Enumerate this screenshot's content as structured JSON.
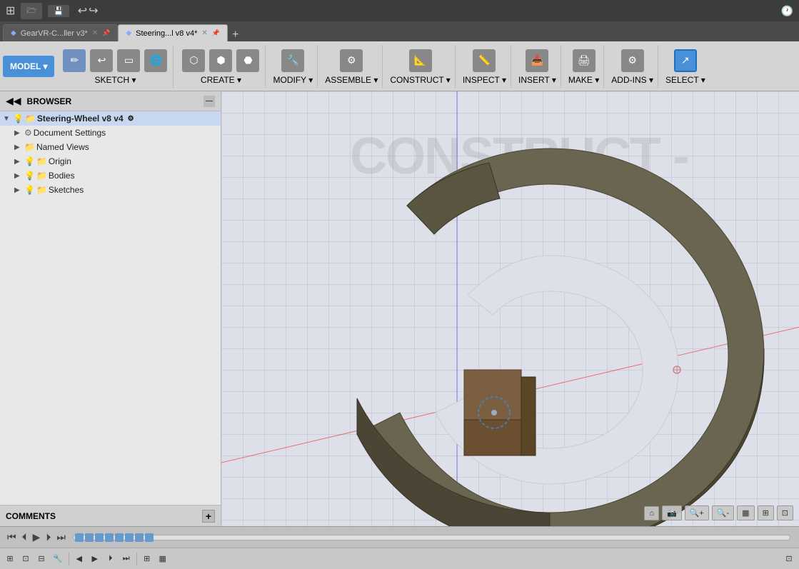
{
  "titlebar": {
    "app_grid_icon": "⊞",
    "file_btn": "File",
    "undo_icon": "↩",
    "redo_icon": "↪",
    "clock_icon": "🕐"
  },
  "tabs": [
    {
      "label": "GearVR-C...ller v3*",
      "active": false,
      "icon": "◆"
    },
    {
      "label": "Steering...l v8 v4*",
      "active": true,
      "icon": "◆"
    }
  ],
  "tab_add_label": "+",
  "toolbar": {
    "model_btn": "MODEL ▾",
    "groups": [
      {
        "name": "sketch",
        "label": "SKETCH ▾",
        "icons": [
          "✏️",
          "↩",
          "▭",
          "🌐"
        ]
      },
      {
        "name": "create",
        "label": "CREATE ▾",
        "icons": [
          "⬡",
          "⬢",
          "⬣"
        ]
      },
      {
        "name": "modify",
        "label": "MODIFY ▾",
        "icons": [
          "🔧"
        ]
      },
      {
        "name": "assemble",
        "label": "ASSEMBLE ▾",
        "icons": [
          "⚙"
        ]
      },
      {
        "name": "construct",
        "label": "CONSTRUCT ▾",
        "icons": [
          "📐"
        ]
      },
      {
        "name": "inspect",
        "label": "INSPECT ▾",
        "icons": [
          "📏"
        ]
      },
      {
        "name": "insert",
        "label": "INSERT ▾",
        "icons": [
          "📥"
        ]
      },
      {
        "name": "make",
        "label": "MAKE ▾",
        "icons": [
          "🖨"
        ]
      },
      {
        "name": "addins",
        "label": "ADD-INS ▾",
        "icons": [
          "⚙"
        ]
      },
      {
        "name": "select",
        "label": "SELECT ▾",
        "icons": [
          "↗"
        ],
        "active": true
      }
    ]
  },
  "browser": {
    "title": "BROWSER",
    "root_item": "Steering-Wheel v8 v4",
    "items": [
      {
        "label": "Document Settings",
        "level": 1,
        "icon": "gear",
        "arrow": "▶"
      },
      {
        "label": "Named Views",
        "level": 1,
        "icon": "folder",
        "arrow": "▶"
      },
      {
        "label": "Origin",
        "level": 1,
        "icon": "folder",
        "arrow": "▶",
        "bulb": true
      },
      {
        "label": "Bodies",
        "level": 1,
        "icon": "folder",
        "arrow": "▶",
        "bulb": true
      },
      {
        "label": "Sketches",
        "level": 1,
        "icon": "folder",
        "arrow": "▶",
        "bulb": true
      }
    ]
  },
  "comments": {
    "label": "COMMENTS",
    "plus": "+"
  },
  "viewport_controls": [
    {
      "label": "⊞",
      "name": "home-view"
    },
    {
      "label": "📷",
      "name": "camera"
    },
    {
      "label": "🔍+",
      "name": "zoom-fit"
    },
    {
      "label": "🔍-",
      "name": "zoom-out"
    },
    {
      "label": "▦",
      "name": "display-mode"
    },
    {
      "label": "⊞⊟",
      "name": "grid-toggle"
    },
    {
      "label": "⊞⊡",
      "name": "grid-settings"
    }
  ],
  "timeline": {
    "play": "▶",
    "prev": "◀",
    "next": "▶",
    "first": "⏮",
    "last": "⏭",
    "markers": 8
  },
  "construct_watermark": "CONSTRUCT -"
}
